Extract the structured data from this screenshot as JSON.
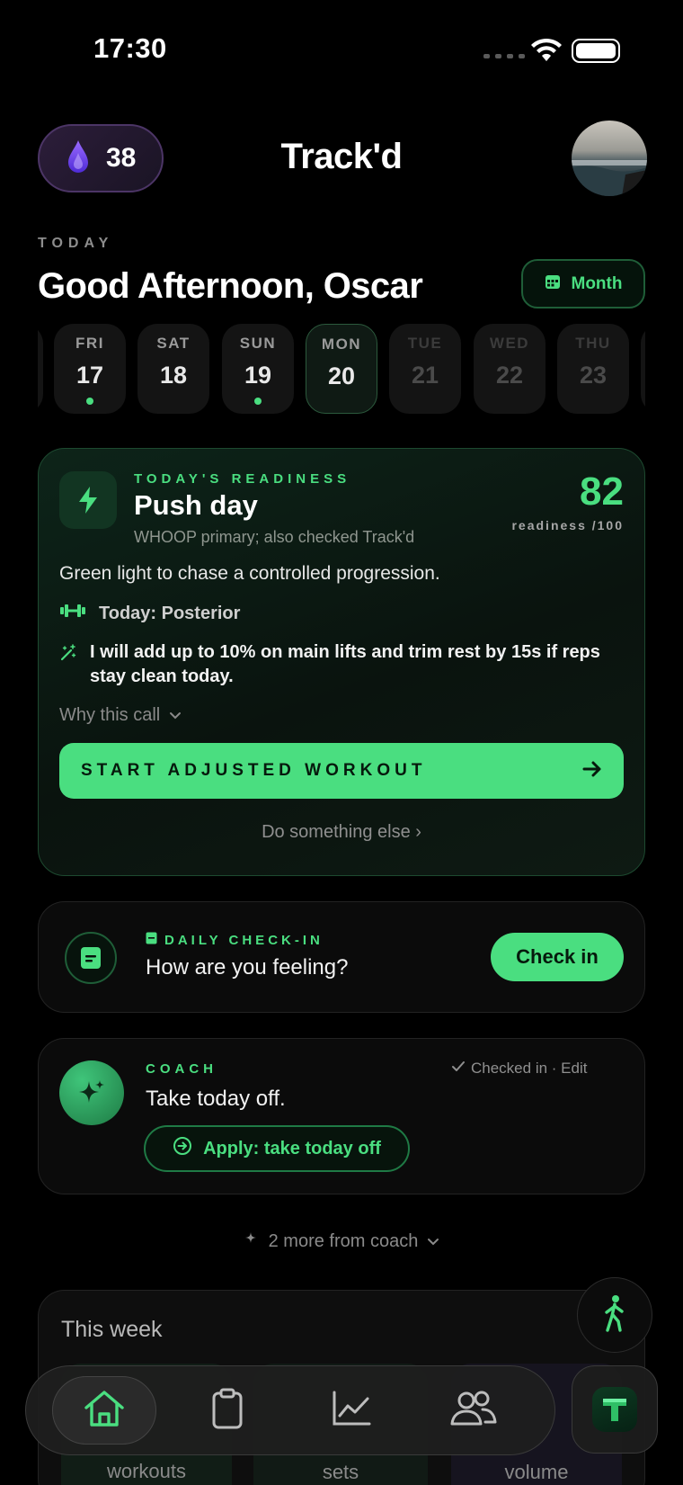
{
  "status_bar": {
    "time": "17:30"
  },
  "header": {
    "streak_count": "38",
    "app_title": "Track'd"
  },
  "greeting": {
    "today_label": "TODAY",
    "text": "Good Afternoon, Oscar",
    "month_button": "Month"
  },
  "days": [
    {
      "dow": "FRI",
      "num": "17",
      "has_dot": true,
      "state": "past"
    },
    {
      "dow": "SAT",
      "num": "18",
      "has_dot": false,
      "state": "past"
    },
    {
      "dow": "SUN",
      "num": "19",
      "has_dot": true,
      "state": "past"
    },
    {
      "dow": "MON",
      "num": "20",
      "has_dot": false,
      "state": "selected"
    },
    {
      "dow": "TUE",
      "num": "21",
      "has_dot": false,
      "state": "future"
    },
    {
      "dow": "WED",
      "num": "22",
      "has_dot": false,
      "state": "future"
    },
    {
      "dow": "THU",
      "num": "23",
      "has_dot": false,
      "state": "future"
    }
  ],
  "readiness": {
    "label": "TODAY'S READINESS",
    "title": "Push day",
    "subtitle": "WHOOP primary; also checked Track'd",
    "score": "82",
    "score_label": "readiness /100",
    "message": "Green light to chase a controlled progression.",
    "focus": "Today: Posterior",
    "plan": "I will add up to 10% on main lifts and trim rest by 15s if reps stay clean today.",
    "why_link": "Why this call",
    "start_button": "START ADJUSTED WORKOUT",
    "alt_link": "Do something else ›"
  },
  "checkin": {
    "label": "DAILY CHECK-IN",
    "question": "How are you feeling?",
    "button": "Check in"
  },
  "coach": {
    "label": "COACH",
    "status": "Checked in · Edit",
    "message": "Take today off.",
    "apply_button": "Apply: take today off",
    "more": "2 more from coach"
  },
  "this_week": {
    "title": "This week",
    "stats": [
      "workouts",
      "sets",
      "volume"
    ]
  },
  "colors": {
    "accent": "#4ade80",
    "background": "#000000",
    "card": "#0b0b0b",
    "streak_flame": "#7c4dff"
  },
  "tabs": [
    {
      "icon": "home-icon",
      "active": true
    },
    {
      "icon": "clipboard-icon",
      "active": false
    },
    {
      "icon": "chart-icon",
      "active": false
    },
    {
      "icon": "people-icon",
      "active": false
    }
  ]
}
